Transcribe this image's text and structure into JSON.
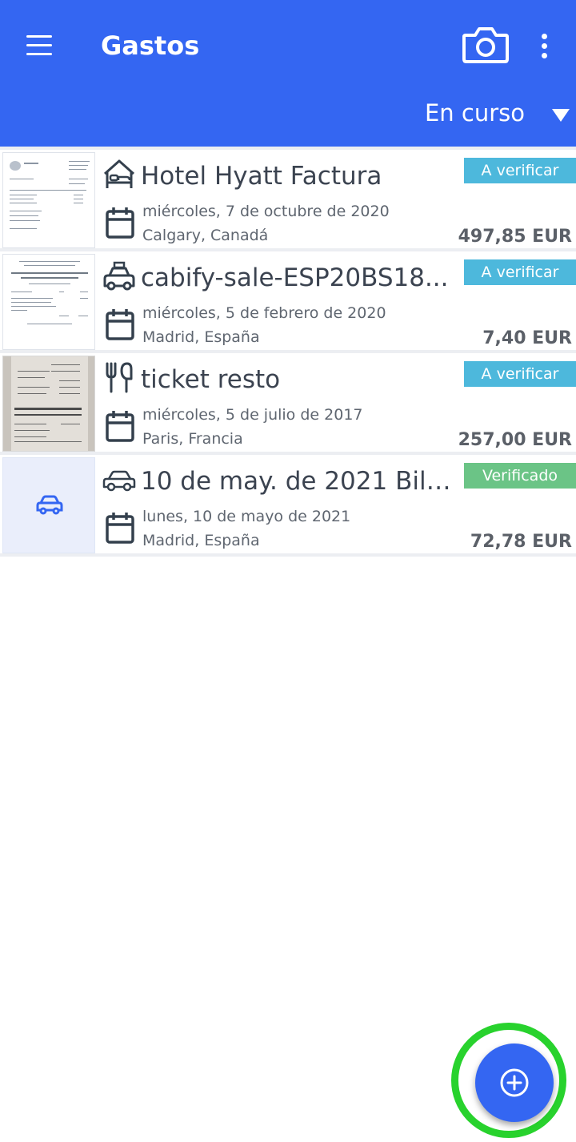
{
  "header": {
    "title": "Gastos",
    "filter": "En curso",
    "icons": {
      "menu": "menu-icon",
      "camera": "camera-icon",
      "more": "more-vert-icon",
      "filter": "caret-down-icon"
    },
    "color": "#3466f2"
  },
  "expenses": [
    {
      "title": "Hotel Hyatt Factura",
      "date": "miércoles, 7 de octubre de 2020",
      "location": "Calgary, Canadá",
      "amount": "497,85 EUR",
      "status": "A verificar",
      "status_color": "#4db8dc",
      "category_icon": "hotel-bed-icon",
      "thumbnail": "receipt-document"
    },
    {
      "title": "cabify-sale-ESP20BS18...",
      "date": "miércoles, 5 de febrero de 2020",
      "location": "Madrid, España",
      "amount": "7,40 EUR",
      "status": "A verificar",
      "status_color": "#4db8dc",
      "category_icon": "taxi-icon",
      "thumbnail": "receipt-document"
    },
    {
      "title": "ticket resto",
      "date": "miércoles, 5 de julio de 2017",
      "location": "Paris, Francia",
      "amount": "257,00 EUR",
      "status": "A verificar",
      "status_color": "#4db8dc",
      "category_icon": "restaurant-icon",
      "thumbnail": "receipt-photo"
    },
    {
      "title": "10 de may. de 2021 Bilb...",
      "date": "lunes, 10 de mayo de 2021",
      "location": "Madrid, España",
      "amount": "72,78 EUR",
      "status": "Verificado",
      "status_color": "#6bc486",
      "category_icon": "car-icon",
      "thumbnail": "car-placeholder"
    }
  ],
  "fab": {
    "icon": "add-circle-icon",
    "highlight_color": "#28d22d"
  }
}
